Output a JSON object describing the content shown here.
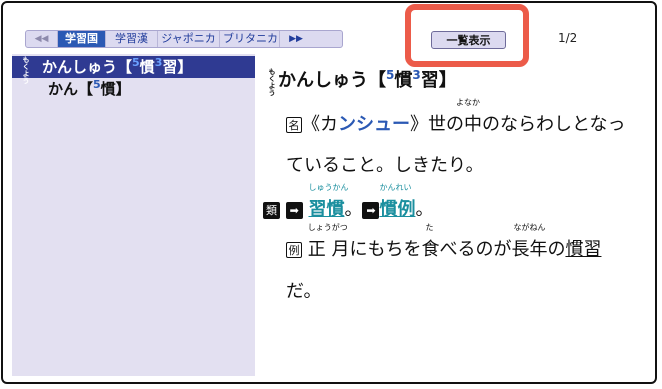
{
  "tabs": {
    "prev": "◀◀",
    "items": [
      "学習国",
      "学習漢",
      "ジャポニカ",
      "ブリタニカ"
    ],
    "next": "▶▶"
  },
  "toolbar": {
    "list_label": "一覧表示",
    "page": "1/2"
  },
  "sidebar": {
    "items": [
      {
        "kana_mark": "もくよう",
        "text": "かんしゅう【",
        "grade": "5",
        "kanji": "慣",
        "grade2": "3",
        "kanji2": "習】"
      },
      {
        "text": "かん【",
        "grade": "5",
        "kanji": "慣】"
      }
    ]
  },
  "entry": {
    "mark": "もくよう",
    "headword": "かんしゅう【",
    "hw_grade": "5",
    "hw_kanji": "慣",
    "hw_grade2": "3",
    "hw_kanji2": "習】",
    "pos_icon": "名",
    "def1_a": "《カ",
    "def1_b": "ンシュー",
    "def1_c": "》世の",
    "def1_d": "中",
    "def1_d_ruby": "なか",
    "def1_e": "のならわしとなっ",
    "def1_e_ruby": "よ",
    "def2": "ていること。しきたり。",
    "syn_icon": "類",
    "syn1": "習慣",
    "syn1_ruby": "しゅうかん",
    "syn_sep": "。",
    "syn2": "慣例",
    "syn2_ruby": "かんれい",
    "syn_end": "。",
    "ex_icon": "例",
    "ex_a": "正",
    "ex_a_ruby": "しょうがつ",
    "ex_b": " 月にもちを",
    "ex_c": "食",
    "ex_c_ruby": "た",
    "ex_d": "べるのが",
    "ex_e": "長年",
    "ex_e_ruby": "ながねん",
    "ex_f": "の",
    "ex_g": "慣習",
    "ex_end": "だ。"
  }
}
